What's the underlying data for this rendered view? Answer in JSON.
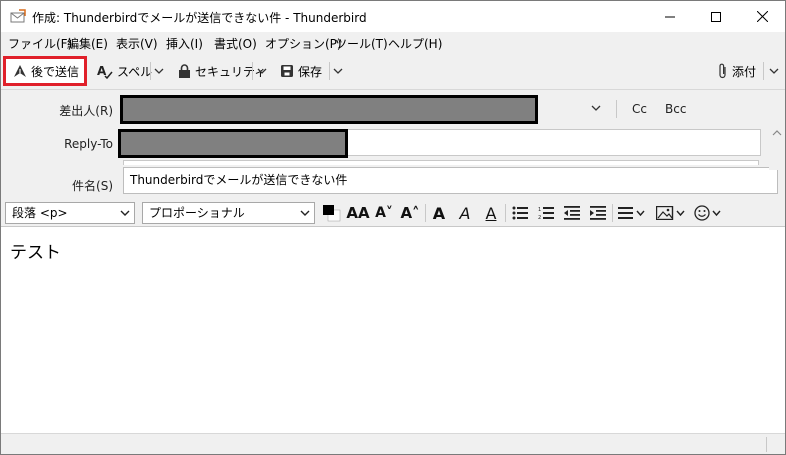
{
  "window": {
    "title": "作成: Thunderbirdでメールが送信できない件 - Thunderbird",
    "controls": {
      "minimize_icon": "minimize-icon",
      "maximize_icon": "maximize-icon",
      "close_icon": "close-icon"
    }
  },
  "menu": {
    "items": [
      "ファイル(F)",
      "編集(E)",
      "表示(V)",
      "挿入(I)",
      "書式(O)",
      "オプション(P)",
      "ツール(T)",
      "ヘルプ(H)"
    ]
  },
  "toolbar": {
    "send_later_label": "後で送信",
    "spell_label": "スペル",
    "security_label": "セキュリティ",
    "save_label": "保存",
    "attach_label": "添付",
    "highlight_color": "#e0202a"
  },
  "headers": {
    "from_label": "差出人(R)",
    "reply_to_label": "Reply-To",
    "subject_label": "件名(S)",
    "subject_value": "Thunderbirdでメールが送信できない件",
    "cc_label": "Cc",
    "bcc_label": "Bcc"
  },
  "format": {
    "paragraph_select": "段落 <p>",
    "font_select": "プロポーショナル"
  },
  "editor": {
    "body_text": "テスト"
  }
}
